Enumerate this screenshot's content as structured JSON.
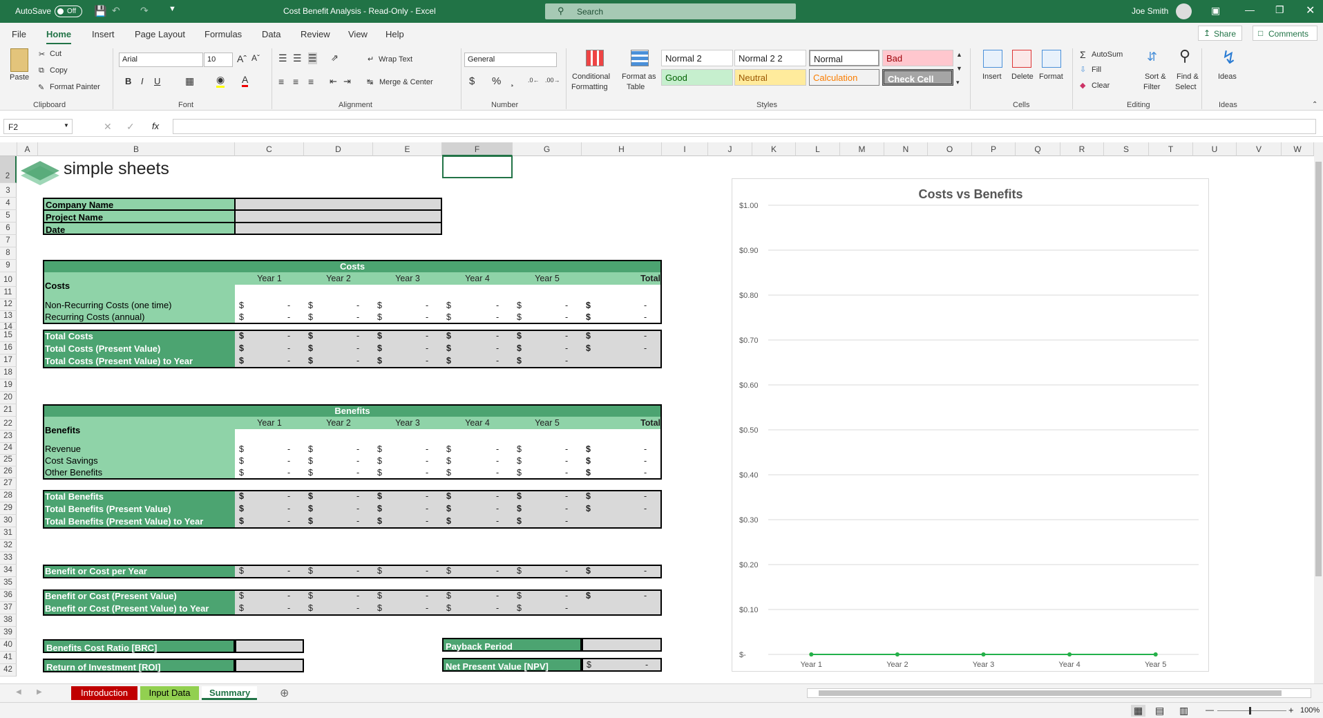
{
  "titlebar": {
    "autosave": "AutoSave",
    "toggle": "Off",
    "doc_title": "Cost Benefit Analysis  -  Read-Only  -  Excel",
    "search": "Search",
    "user": "Joe Smith"
  },
  "tabs": [
    "File",
    "Home",
    "Insert",
    "Page Layout",
    "Formulas",
    "Data",
    "Review",
    "View",
    "Help"
  ],
  "share": "Share",
  "comments": "Comments",
  "ribbon": {
    "paste": "Paste",
    "cut": "Cut",
    "copy": "Copy",
    "format_painter": "Format Painter",
    "font_name": "Arial",
    "font_size": "10",
    "wrap": "Wrap Text",
    "merge": "Merge & Center",
    "number_format": "General",
    "conditional": [
      "Conditional",
      "Formatting"
    ],
    "format_table": [
      "Format as",
      "Table"
    ],
    "styles": [
      "Normal 2",
      "Normal 2 2",
      "Normal",
      "Bad",
      "Good",
      "Neutral",
      "Calculation",
      "Check Cell"
    ],
    "insert": "Insert",
    "delete": "Delete",
    "format": "Format",
    "autosum": "AutoSum",
    "fill": "Fill",
    "clear": "Clear",
    "sort": [
      "Sort &",
      "Filter"
    ],
    "find": [
      "Find &",
      "Select"
    ],
    "ideas": "Ideas",
    "groups": [
      "Clipboard",
      "Font",
      "Alignment",
      "Number",
      "Styles",
      "Cells",
      "Editing",
      "Ideas"
    ]
  },
  "namebox": "F2",
  "columns": [
    "A",
    "B",
    "C",
    "D",
    "E",
    "F",
    "G",
    "H",
    "I",
    "J",
    "K",
    "L",
    "M",
    "N",
    "O",
    "P",
    "Q",
    "R",
    "S",
    "T",
    "U",
    "V",
    "W"
  ],
  "rows": [
    "2",
    "3",
    "4",
    "5",
    "6",
    "7",
    "8",
    "9",
    "10",
    "11",
    "12",
    "13",
    "14",
    "15",
    "16",
    "17",
    "18",
    "19",
    "20",
    "21",
    "22",
    "23",
    "24",
    "25",
    "26",
    "27",
    "28",
    "29",
    "30",
    "31",
    "32",
    "33",
    "34",
    "35",
    "36",
    "37",
    "38",
    "39",
    "40",
    "41",
    "42"
  ],
  "logo": "simple sheets",
  "info": [
    "Company Name",
    "Project Name",
    "Date"
  ],
  "costs": {
    "header": "Costs",
    "label": "Costs",
    "years": [
      "Year 1",
      "Year 2",
      "Year 3",
      "Year 4",
      "Year 5"
    ],
    "total": "Total",
    "rows": [
      "Non-Recurring Costs (one time)",
      "Recurring Costs (annual)"
    ],
    "totals": [
      "Total Costs",
      "Total Costs (Present Value)",
      "Total Costs (Present Value) to Year"
    ]
  },
  "benefits": {
    "header": "Benefits",
    "label": "Benefits",
    "rows": [
      "Revenue",
      "Cost Savings",
      "Other Benefits"
    ],
    "totals": [
      "Total Benefits",
      "Total Benefits (Present Value)",
      "Total Benefits (Present Value) to Year"
    ]
  },
  "summary": [
    "Benefit or Cost per Year",
    "Benefit or Cost (Present Value)",
    "Benefit or Cost (Present Value) to Year"
  ],
  "metrics": {
    "brc": "Benefits Cost Ratio [BRC]",
    "roi": "Return of Investment [ROI]",
    "payback": "Payback Period",
    "npv": "Net Present Value [NPV]"
  },
  "currency": "$",
  "dash": "-",
  "chart_data": {
    "type": "line",
    "title": "Costs vs Benefits",
    "categories": [
      "Year 1",
      "Year 2",
      "Year 3",
      "Year 4",
      "Year 5"
    ],
    "yticks": [
      "$-",
      "$0.10",
      "$0.20",
      "$0.30",
      "$0.40",
      "$0.50",
      "$0.60",
      "$0.70",
      "$0.80",
      "$0.90",
      "$1.00"
    ],
    "ylim": [
      0,
      1
    ],
    "series": [
      {
        "name": "Total Costs (Present Value) to Year",
        "color": "#f39c12",
        "values": [
          0,
          0,
          0,
          0,
          0
        ]
      },
      {
        "name": "Total Benefits (Present Value) to Year",
        "color": "#22b14c",
        "values": [
          0,
          0,
          0,
          0,
          0
        ]
      }
    ],
    "legend": "bottom"
  },
  "sheets": [
    "Introduction",
    "Input Data",
    "Summary"
  ],
  "zoom": "100%"
}
